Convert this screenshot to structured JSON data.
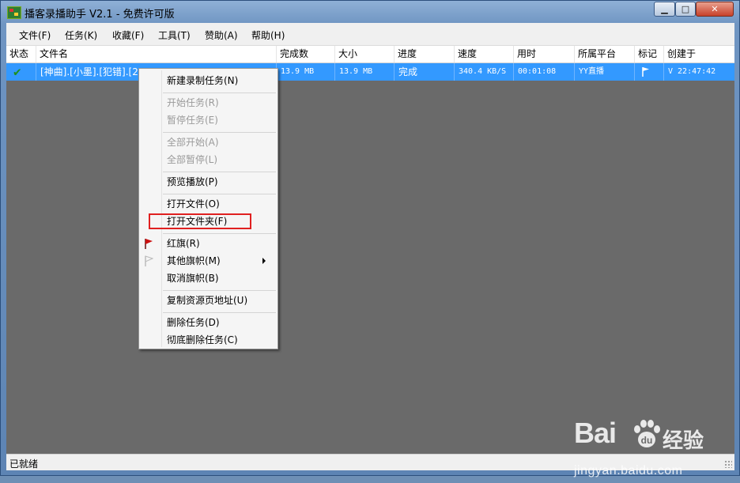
{
  "window": {
    "title": "播客录播助手 V2.1 - 免费许可版",
    "controls": {
      "minimize": "▁",
      "maximize": "□",
      "close": "✕"
    }
  },
  "menu": [
    "文件(F)",
    "任务(K)",
    "收藏(F)",
    "工具(T)",
    "赞助(A)",
    "帮助(H)"
  ],
  "table": {
    "columns": [
      "状态",
      "文件名",
      "完成数",
      "大小",
      "进度",
      "速度",
      "用时",
      "所属平台",
      "标记",
      "创建于"
    ],
    "rows": [
      {
        "status_icon": "check-icon",
        "filename": "[神曲].[小墨].[犯错].[20",
        "completed": "13.9 MB",
        "size": "13.9 MB",
        "progress": "完成",
        "speed": "340.4 KB/S",
        "elapsed": "00:01:08",
        "platform": "YY直播",
        "mark_icon": "white-flag-icon",
        "created": "V 22:47:42"
      }
    ]
  },
  "context_menu": {
    "items": [
      "新建录制任务(N)",
      "开始任务(R)",
      "暂停任务(E)",
      "全部开始(A)",
      "全部暂停(L)",
      "预览播放(P)",
      "打开文件(O)",
      "打开文件夹(F)",
      "红旗(R)",
      "其他旗帜(M)",
      "取消旗帜(B)",
      "复制资源页地址(U)",
      "删除任务(D)",
      "彻底删除任务(C)"
    ],
    "disabled": [
      "开始任务(R)",
      "暂停任务(E)",
      "全部开始(A)",
      "全部暂停(L)"
    ],
    "highlighted": "打开文件夹(F)",
    "highlight_color": "#e02020"
  },
  "statusbar": {
    "text": "已就绪"
  },
  "watermark": {
    "logo": "Bai",
    "logo_suffix": "经验",
    "url": "jingyan.baidu.com"
  },
  "colors": {
    "selection": "#3399ff",
    "background": "#6a6a6a",
    "red_flag": "#cc1111"
  }
}
